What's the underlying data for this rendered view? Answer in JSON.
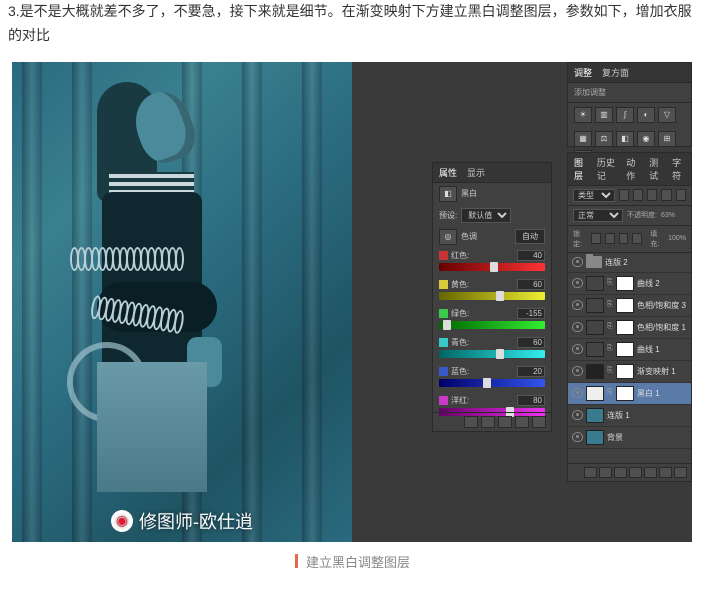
{
  "article": {
    "step_text": "3.是不是大概就差不多了，不要急，接下来就是细节。在渐变映射下方建立黑白调整图层，参数如下，增加衣服的对比",
    "caption": "建立黑白调整图层",
    "watermark": "修图师-欧仕逍"
  },
  "adjustments_panel": {
    "tab1": "调整",
    "tab2": "复方面",
    "subtitle": "添加调整"
  },
  "properties_panel": {
    "title": "属性",
    "subtitle": "显示",
    "type_label": "黑白",
    "preset_label": "预设:",
    "preset_value": "默认值",
    "auto_label": "自动",
    "tint_label": "色调",
    "sliders": [
      {
        "label": "红色:",
        "value": "40",
        "color": "#c93434",
        "grad": "linear-gradient(90deg,#600,#f33)",
        "pos": 52
      },
      {
        "label": "黄色:",
        "value": "60",
        "color": "#d8c93a",
        "grad": "linear-gradient(90deg,#660,#ee3)",
        "pos": 58
      },
      {
        "label": "绿色:",
        "value": "-155",
        "color": "#3ac94a",
        "grad": "linear-gradient(90deg,#060,#3e3)",
        "pos": 8
      },
      {
        "label": "青色:",
        "value": "60",
        "color": "#3ac9c9",
        "grad": "linear-gradient(90deg,#066,#3ee)",
        "pos": 58
      },
      {
        "label": "蓝色:",
        "value": "20",
        "color": "#3a5ac9",
        "grad": "linear-gradient(90deg,#006,#35e)",
        "pos": 45
      },
      {
        "label": "洋红:",
        "value": "80",
        "color": "#c93ac9",
        "grad": "linear-gradient(90deg,#606,#e3e)",
        "pos": 67
      }
    ]
  },
  "layers_panel": {
    "tabs": [
      "图层",
      "历史记",
      "动作",
      "测试",
      "字符"
    ],
    "kind_label": "类型",
    "blend_mode": "正常",
    "opacity_label": "不透明度:",
    "opacity_value": "63%",
    "lock_label": "锁定:",
    "fill_label": "填充:",
    "fill_value": "100%",
    "layers": [
      {
        "name": "连版 2",
        "type": "folder",
        "selected": false
      },
      {
        "name": "曲线 2",
        "type": "adj",
        "selected": false
      },
      {
        "name": "色相/饱和度 3",
        "type": "adj",
        "selected": false
      },
      {
        "name": "色相/饱和度 1",
        "type": "adj",
        "selected": false
      },
      {
        "name": "曲线 1",
        "type": "adj",
        "selected": false
      },
      {
        "name": "渐变映射 1",
        "type": "adj",
        "selected": false,
        "darkthumb": true
      },
      {
        "name": "黑白 1",
        "type": "adj",
        "selected": true,
        "whitethumb": true
      },
      {
        "name": "连版 1",
        "type": "img",
        "selected": false
      },
      {
        "name": "背景",
        "type": "img",
        "selected": false
      }
    ]
  }
}
